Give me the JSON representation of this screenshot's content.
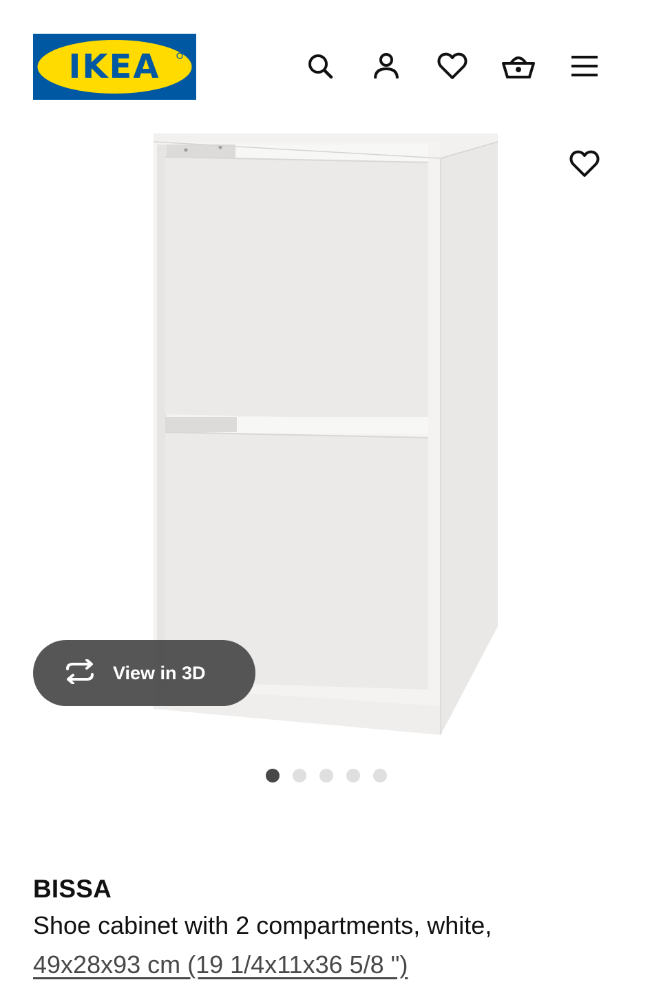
{
  "header": {
    "logo_text": "IKEA",
    "logo_colors": {
      "blue": "#0058a3",
      "yellow": "#ffdb00"
    },
    "icons": [
      "search-icon",
      "account-icon",
      "heart-icon",
      "basket-icon",
      "menu-icon"
    ]
  },
  "gallery": {
    "view_3d_label": "View in 3D",
    "dots": [
      true,
      false,
      false,
      false,
      false
    ]
  },
  "product": {
    "name": "BISSA",
    "description": "Shoe cabinet with 2 compartments, white,",
    "dimensions": "49x28x93 cm (19 1/4x11x36 5/8 \")"
  }
}
